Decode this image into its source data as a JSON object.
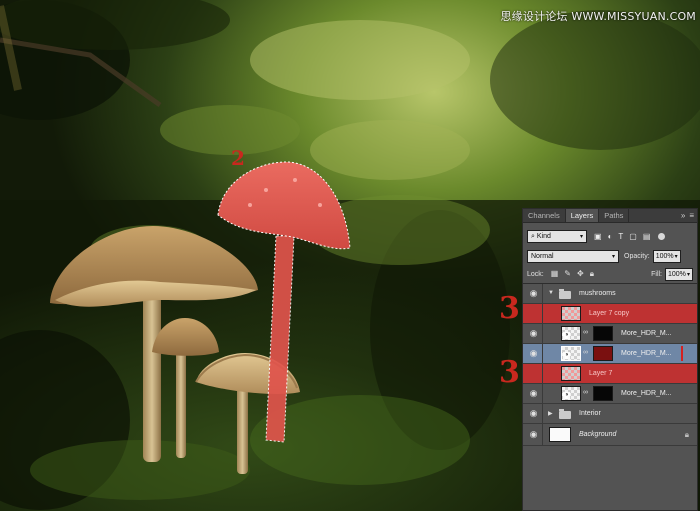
{
  "watermark": "思缘设计论坛 WWW.MISSYUAN.COM",
  "annotations": {
    "step2": "2",
    "step3_top": "3",
    "step3_bottom": "3"
  },
  "colors": {
    "highlight": "#cd2e2e",
    "selected": "#6f87a6",
    "panel_bg": "#535353",
    "mushroom_selected": "#e0544c"
  },
  "layers_panel": {
    "tabs": [
      {
        "label": "Channels"
      },
      {
        "label": "Layers"
      },
      {
        "label": "Paths"
      }
    ],
    "active_tab": "Layers",
    "filter": {
      "kind": "Kind"
    },
    "blend_mode": "Normal",
    "opacity_label": "Opacity:",
    "opacity": "100%",
    "lock_label": "Lock:",
    "fill_label": "Fill:",
    "fill": "100%",
    "layers": [
      {
        "name": "mushrooms",
        "type": "group",
        "expanded": true
      },
      {
        "name": "Layer 7 copy",
        "state": "highlighted"
      },
      {
        "name": "More_HDR_M...",
        "thumb": "checker"
      },
      {
        "name": "More_HDR_M...",
        "state": "selected"
      },
      {
        "name": "Layer 7",
        "state": "highlighted"
      },
      {
        "name": "More_HDR_M...",
        "thumb": "checker"
      },
      {
        "name": "Interior",
        "type": "group",
        "expanded": false
      },
      {
        "name": "Background",
        "locked": true
      }
    ]
  }
}
